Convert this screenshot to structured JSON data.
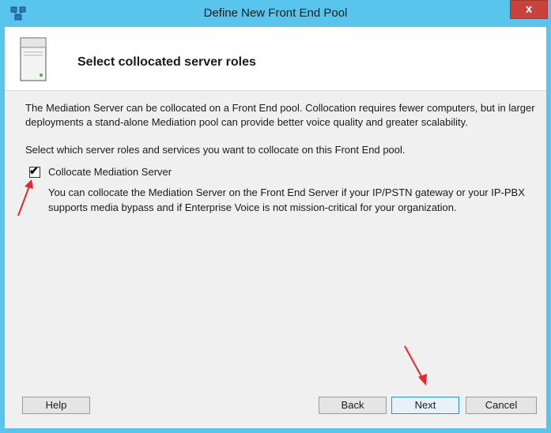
{
  "window": {
    "title": "Define New Front End Pool",
    "close_label": "x",
    "title_icon": "topology-builder-icon",
    "accent_color": "#59c4ec",
    "close_color": "#c8433b"
  },
  "header": {
    "icon": "server-icon",
    "title": "Select collocated server roles"
  },
  "content": {
    "description": "The Mediation Server can be collocated on a Front End pool. Collocation requires fewer computers, but in larger deployments a stand-alone Mediation pool can provide better voice quality and greater scalability.",
    "instruction": "Select which server roles and services you want to collocate on this Front End pool.",
    "option": {
      "label": "Collocate Mediation Server",
      "checked": true,
      "check_glyph": "✔",
      "description": "You can collocate the Mediation Server on the Front End Server if your IP/PSTN gateway or your IP-PBX supports media bypass and if Enterprise Voice is not mission-critical for your organization."
    }
  },
  "footer": {
    "help_label": "Help",
    "back_label": "Back",
    "next_label": "Next",
    "cancel_label": "Cancel"
  },
  "annotations": {
    "arrow_color": "#e8262b",
    "arrows": [
      "arrow-to-checkbox",
      "arrow-to-next-button"
    ]
  }
}
